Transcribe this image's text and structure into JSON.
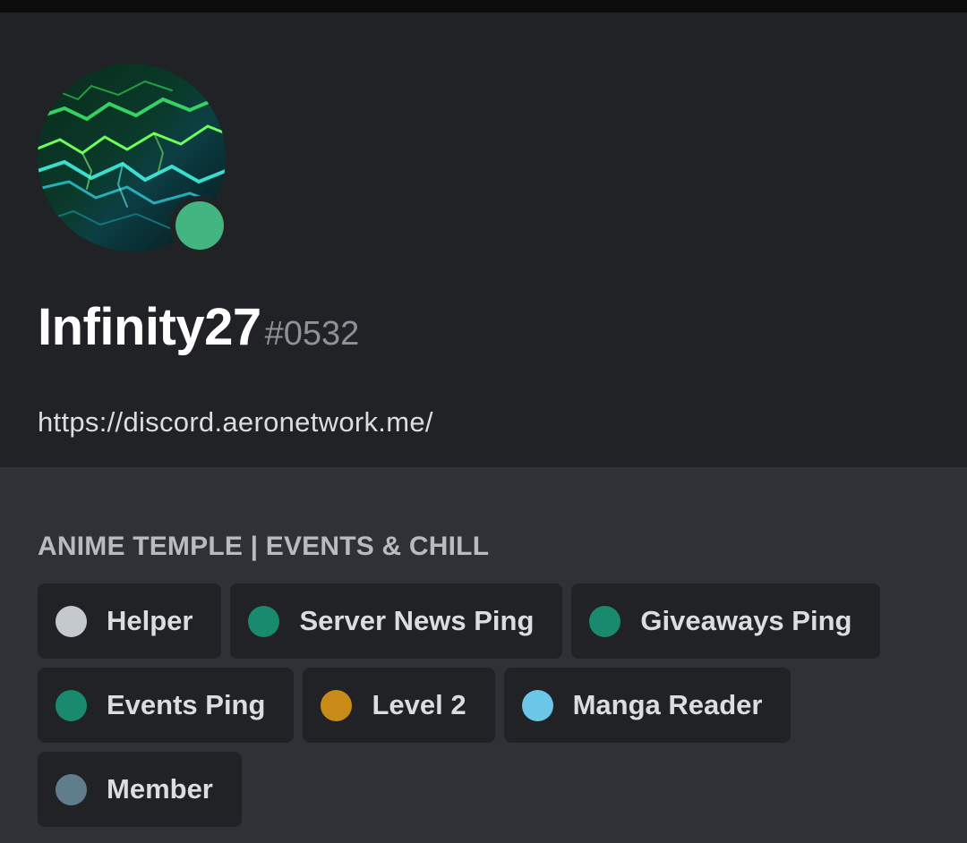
{
  "profile": {
    "username": "Infinity27",
    "discriminator": "#0532",
    "status": "online",
    "status_color": "#43b581",
    "about": "https://discord.aeronetwork.me/"
  },
  "server": {
    "name": "ANIME TEMPLE | EVENTS & CHILL"
  },
  "roles": [
    {
      "label": "Helper",
      "color": "#c4c9ce"
    },
    {
      "label": "Server News Ping",
      "color": "#1a8a6e"
    },
    {
      "label": "Giveaways Ping",
      "color": "#1a8a6e"
    },
    {
      "label": "Events Ping",
      "color": "#1a8a6e"
    },
    {
      "label": "Level 2",
      "color": "#c98a17"
    },
    {
      "label": "Manga Reader",
      "color": "#6cc6e8"
    },
    {
      "label": "Member",
      "color": "#607d8b"
    }
  ]
}
